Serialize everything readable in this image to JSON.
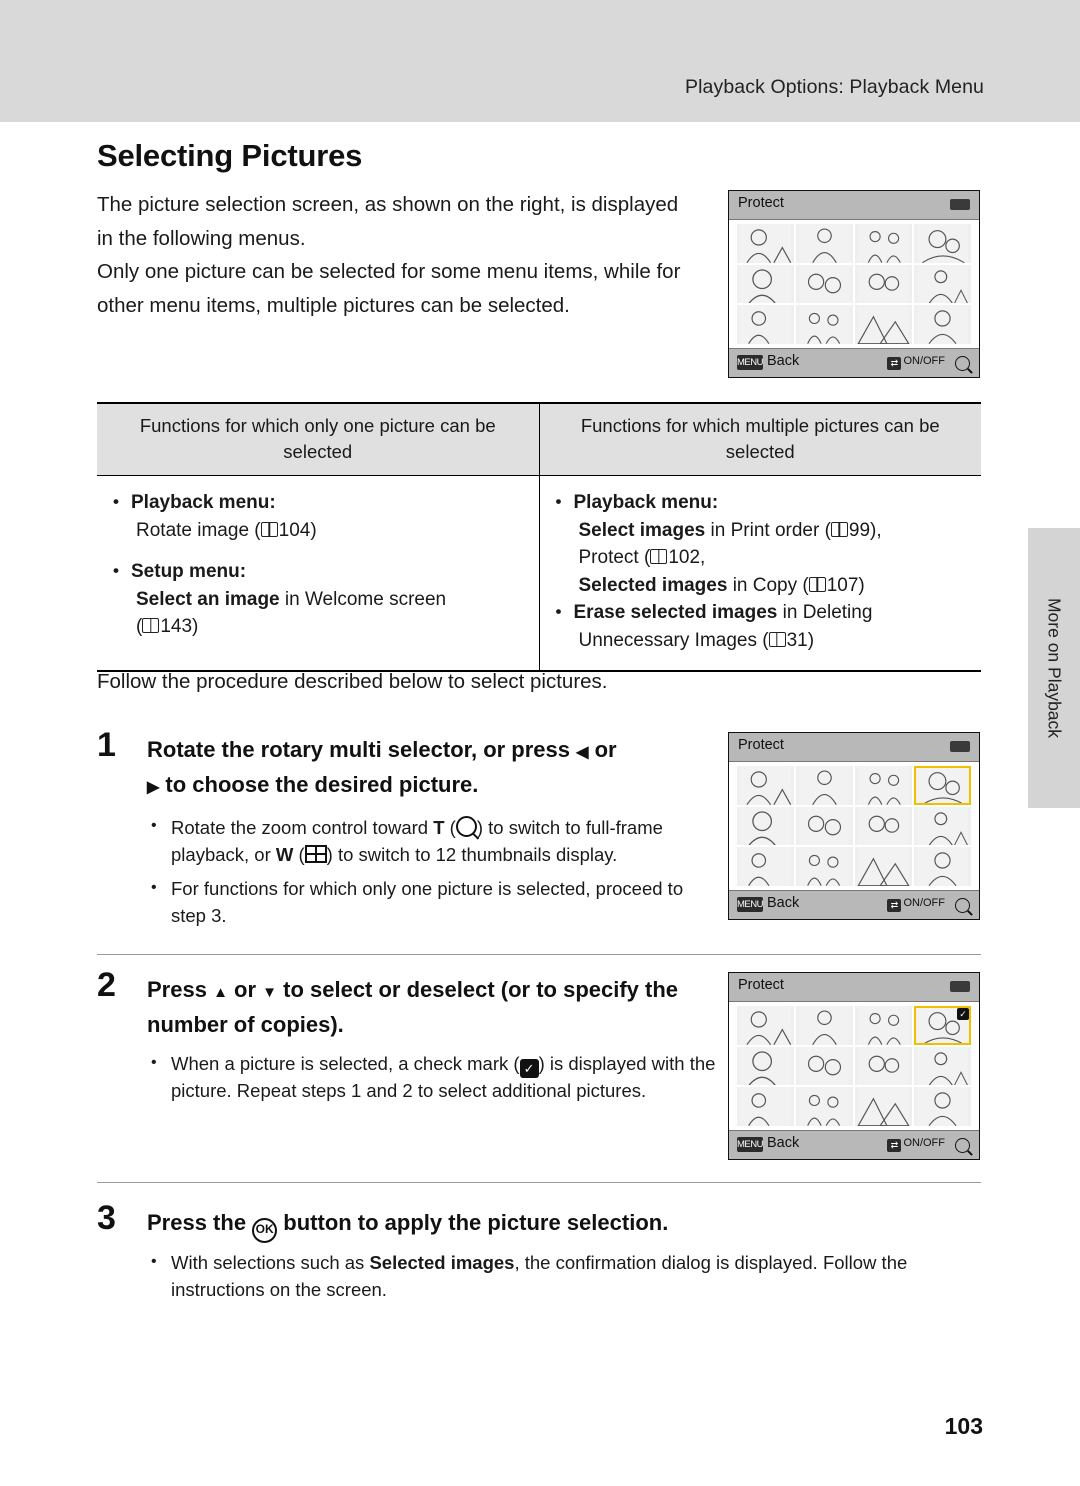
{
  "header": {
    "running_head": "Playback Options: Playback Menu"
  },
  "section": {
    "title": "Selecting Pictures",
    "intro_p1": "The picture selection screen, as shown on the right, is displayed in the following menus.",
    "intro_p2": "Only one picture can be selected for some menu items, while for other menu items, multiple pictures can be selected."
  },
  "table": {
    "head_left": "Functions for which only one picture can be selected",
    "head_right": "Functions for which multiple pictures can be selected",
    "left": {
      "b1_label": "Playback menu:",
      "b1_line1": "Rotate image (",
      "b1_ref1": "104)",
      "b2_label": "Setup menu:",
      "b2_bold": "Select an image",
      "b2_rest": " in Welcome screen",
      "b2_ref": "143)"
    },
    "right": {
      "b1_label": "Playback menu:",
      "r1_bold": "Select images",
      "r1_rest": " in Print order (",
      "r1_ref": "99),",
      "r2_text": "Protect (",
      "r2_ref": "102,",
      "r3_bold": "Selected images",
      "r3_rest": " in Copy (",
      "r3_ref": "107)",
      "b2_bold": "Erase selected images",
      "b2_rest": " in Deleting",
      "r4_text": "Unnecessary Images (",
      "r4_ref": "31)"
    }
  },
  "follow_line": "Follow the procedure described below to select pictures.",
  "steps": [
    {
      "number": "1",
      "title_a": "Rotate the rotary multi selector, or press ",
      "title_b": " or",
      "title_c": " to choose the desired picture.",
      "bullets": [
        {
          "a": "Rotate the zoom control toward ",
          "t": "T",
          "b": " (",
          "c": ") to switch to full-frame playback, or ",
          "w": "W",
          "d": " (",
          "e": ") to switch to 12 thumbnails display."
        },
        {
          "plain": "For functions for which only one picture is selected, proceed to step 3."
        }
      ]
    },
    {
      "number": "2",
      "title_a": "Press ",
      "title_b": " or ",
      "title_c": " to select or deselect (or to specify the number of copies).",
      "bullets": [
        {
          "a": "When a picture is selected, a check mark (",
          "b": ") is displayed with the picture. Repeat steps 1 and 2 to select additional pictures."
        }
      ]
    },
    {
      "number": "3",
      "title_a": "Press the ",
      "title_c": " button to apply the picture selection.",
      "bullets": [
        {
          "a": "With selections such as ",
          "bold": "Selected images",
          "b": ", the confirmation dialog is displayed. Follow the instructions on the screen."
        }
      ]
    }
  ],
  "camera_screens": [
    {
      "id": "protect-screen-1",
      "title": "Protect",
      "menu_key": "MENU",
      "back_label": "Back",
      "onoff_key": "ON/OFF",
      "selected_index": -1,
      "checked": []
    },
    {
      "id": "protect-screen-2",
      "title": "Protect",
      "menu_key": "MENU",
      "back_label": "Back",
      "onoff_key": "ON/OFF",
      "selected_index": 3,
      "checked": []
    },
    {
      "id": "protect-screen-3",
      "title": "Protect",
      "menu_key": "MENU",
      "back_label": "Back",
      "onoff_key": "ON/OFF",
      "selected_index": 3,
      "checked": [
        3
      ]
    }
  ],
  "side_tab": {
    "label": "More on Playback"
  },
  "footer": {
    "page_number": "103"
  },
  "colors": {
    "header_band": "#d9d9d9",
    "table_header": "#e0e0e0",
    "side_tab": "#d4d4d4",
    "camera_chrome": "#b8b8b8",
    "selection_highlight": "#f0c000"
  }
}
